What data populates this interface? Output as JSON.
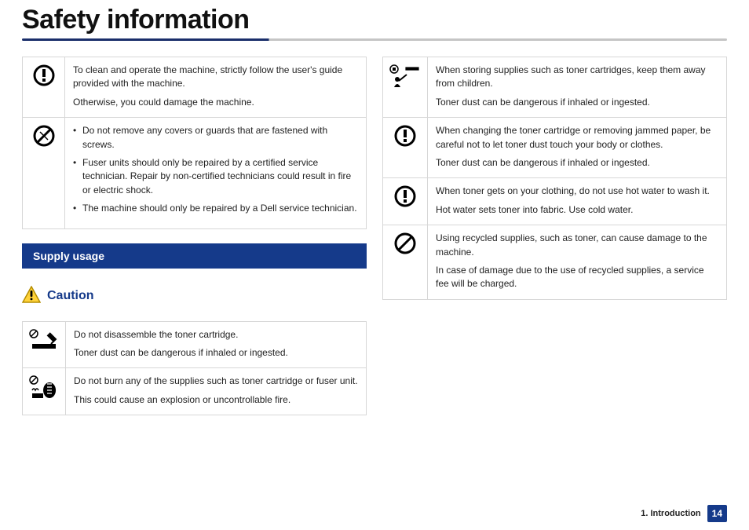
{
  "page_title": "Safety information",
  "left_top_rows": [
    {
      "icon": "exclaim-circle",
      "paras": [
        "To clean and operate the machine, strictly follow the user's guide provided with the machine.",
        "Otherwise, you could damage the machine."
      ]
    },
    {
      "icon": "prohibit-tools",
      "bullets": [
        "Do not remove any covers or guards that are fastened with screws.",
        "Fuser units should only be repaired by a certified service technician. Repair by non-certified technicians could result in fire or electric shock.",
        "The machine should only be repaired by a Dell service technician."
      ]
    }
  ],
  "section_header": "Supply usage",
  "caution_label": "Caution",
  "left_bottom_rows": [
    {
      "icon": "disassemble-cartridge",
      "paras": [
        "Do not disassemble the toner cartridge.",
        "Toner dust can be dangerous if inhaled or ingested."
      ]
    },
    {
      "icon": "burn-cartridge",
      "paras": [
        "Do not burn any of the supplies such as toner cartridge or fuser unit.",
        "This could cause an explosion or uncontrollable fire."
      ]
    }
  ],
  "right_rows": [
    {
      "icon": "keep-away-child",
      "paras": [
        "When storing supplies such as toner cartridges, keep them away from children.",
        "Toner dust can be dangerous if inhaled or ingested."
      ]
    },
    {
      "icon": "exclaim-circle",
      "paras": [
        "When changing the toner cartridge or removing jammed paper, be careful not to let toner dust touch your body or clothes.",
        "Toner dust can be dangerous if inhaled or ingested."
      ]
    },
    {
      "icon": "exclaim-circle",
      "paras": [
        "When toner gets on your clothing, do not use hot water to wash it.",
        "Hot water sets toner into fabric. Use cold water."
      ]
    },
    {
      "icon": "prohibit-circle",
      "paras": [
        "Using recycled supplies, such as toner, can cause damage to the machine.",
        "In case of damage due to the use of recycled supplies, a service fee will be charged."
      ]
    }
  ],
  "footer": {
    "chapter": "1. Introduction",
    "page": "14"
  }
}
